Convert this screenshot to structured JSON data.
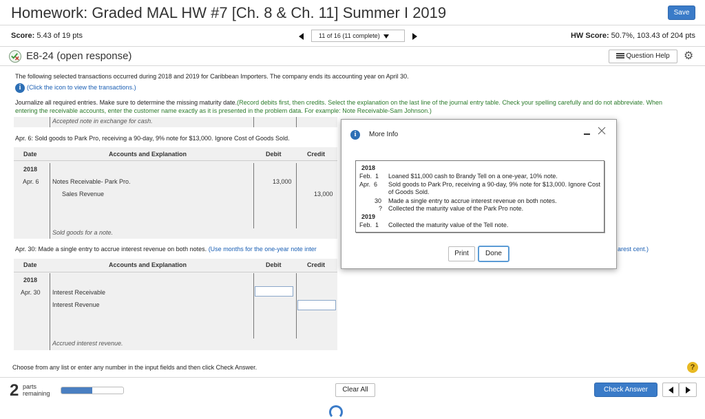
{
  "header": {
    "title": "Homework: Graded MAL HW #7 [Ch. 8 & Ch. 11] Summer I 2019",
    "save_label": "Save"
  },
  "score_bar": {
    "score_label": "Score:",
    "score_value": "5.43 of 19 pts",
    "question_selector": "11 of 16 (11 complete)",
    "hw_score_label": "HW Score:",
    "hw_score_value": "50.7%, 103.43 of 204 pts"
  },
  "question": {
    "title": "E8-24 (open response)",
    "help_label": "Question Help"
  },
  "intro": {
    "line1": "The following selected transactions occurred during 2018 and 2019 for Caribbean Importers. The company ends its accounting year on April 30.",
    "click_icon": "(Click the icon to view the transactions.)",
    "instructions_start": "Journalize all required entries. Make sure to determine the missing maturity date.",
    "instructions_green": "(Record debits first, then credits. Select the explanation on the last line of the journal entry table. Check your spelling carefully and do not abbreviate. When entering the receivable accounts, enter the customer name exactly as it is presented in the problem data. For example: Note Receivable-Sam Johnson.)"
  },
  "partial_row": {
    "text": "Accepted note in exchange for cash."
  },
  "entry1": {
    "prompt": "Apr. 6: Sold goods to Park Pro, receiving a 90-day, 9% note for $13,000. Ignore Cost of Goods Sold.",
    "headers": {
      "date": "Date",
      "accounts": "Accounts and Explanation",
      "debit": "Debit",
      "credit": "Credit"
    },
    "year": "2018",
    "date": "Apr. 6",
    "rows": [
      {
        "account": "Notes Receivable- Park Pro.",
        "debit": "13,000",
        "credit": ""
      },
      {
        "account": "Sales Revenue",
        "debit": "",
        "credit": "13,000"
      }
    ],
    "explanation": "Sold goods for a note."
  },
  "entry2": {
    "prompt": "Apr. 30: Made a single entry to accrue interest revenue on both notes.",
    "prompt_hint": "(Use months for the one-year note inter",
    "prompt_tail": "arest cent.)",
    "headers": {
      "date": "Date",
      "accounts": "Accounts and Explanation",
      "debit": "Debit",
      "credit": "Credit"
    },
    "year": "2018",
    "date": "Apr. 30",
    "rows": [
      {
        "account": "Interest Receivable"
      },
      {
        "account": "Interest Revenue"
      }
    ],
    "explanation": "Accrued interest revenue."
  },
  "footer": {
    "choose_text": "Choose from any list or enter any number in the input fields and then click Check Answer.",
    "parts_number": "2",
    "parts_label": "parts",
    "remaining_label": "remaining",
    "progress_fraction": 0.5,
    "clear_all_label": "Clear All",
    "check_answer_label": "Check Answer"
  },
  "modal": {
    "title": "More Info",
    "year1": "2018",
    "transactions_2018": [
      {
        "date": "Feb.  1",
        "text": "Loaned $11,000 cash to Brandy Tell on a one-year, 10% note."
      },
      {
        "date": "Apr.  6",
        "text": "Sold goods to Park Pro, receiving a 90-day, 9% note for $13,000. Ignore Cost of Goods Sold."
      },
      {
        "date": "30",
        "text": "Made a single entry to accrue interest revenue on both notes."
      },
      {
        "date": "?",
        "text": "Collected the maturity value of the Park Pro note."
      }
    ],
    "year2": "2019",
    "transactions_2019": [
      {
        "date": "Feb.  1",
        "text": "Collected the maturity value of the Tell note."
      }
    ],
    "print_label": "Print",
    "done_label": "Done"
  },
  "colors": {
    "accent": "#3a7bc8",
    "green_text": "#2a7a2a",
    "link_blue": "#1a5fb4"
  }
}
